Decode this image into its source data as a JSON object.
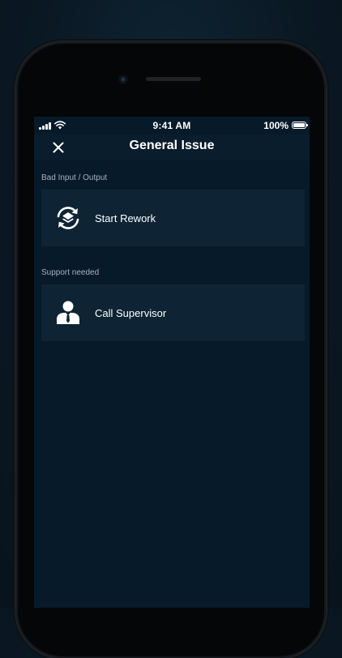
{
  "status_bar": {
    "time": "9:41 AM",
    "battery": "100%"
  },
  "header": {
    "title": "General Issue",
    "close_icon": "close-icon"
  },
  "sections": [
    {
      "label": "Bad Input / Output",
      "items": [
        {
          "label": "Start Rework",
          "icon": "rework-icon"
        }
      ]
    },
    {
      "label": "Support needed",
      "items": [
        {
          "label": "Call Supervisor",
          "icon": "supervisor-icon"
        }
      ]
    }
  ],
  "colors": {
    "background": "#061a2a",
    "card": "#0e2434",
    "text": "#ffffff",
    "muted_text": "#a7b2bc"
  }
}
